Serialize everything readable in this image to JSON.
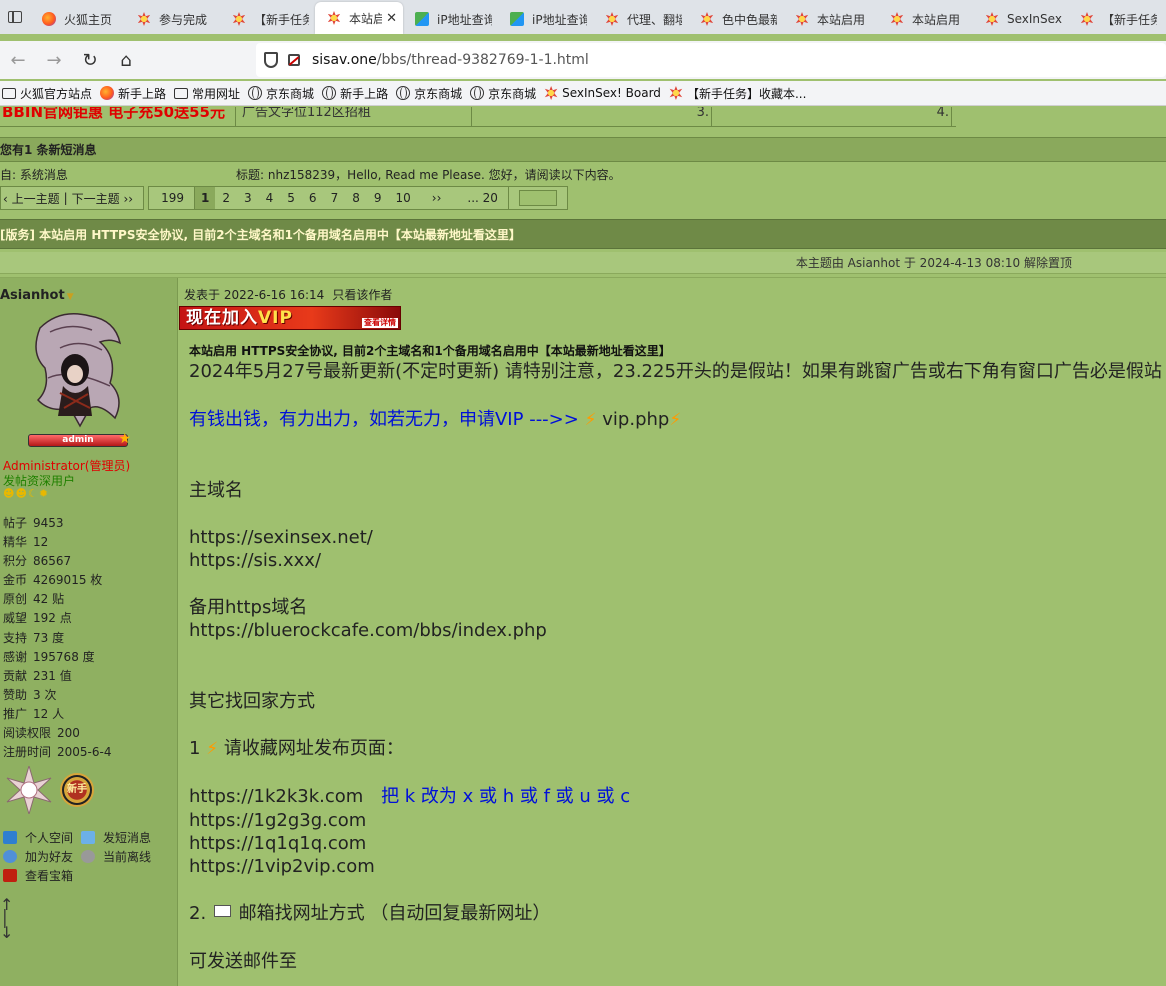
{
  "tabs": [
    {
      "label": "火狐主页",
      "icon": "firefox-icon"
    },
    {
      "label": "参与完成",
      "icon": "flower-icon"
    },
    {
      "label": "【新手任务",
      "icon": "flower-icon"
    },
    {
      "label": "本站启",
      "icon": "flower-icon",
      "active": true
    },
    {
      "label": "iP地址查询",
      "icon": "ip-lookup-icon"
    },
    {
      "label": "iP地址查询",
      "icon": "ip-lookup-icon"
    },
    {
      "label": "代理、翻墙",
      "icon": "flower-icon"
    },
    {
      "label": "色中色最新",
      "icon": "flower-icon"
    },
    {
      "label": "本站启用",
      "icon": "flower-icon"
    },
    {
      "label": "本站启用",
      "icon": "flower-icon"
    },
    {
      "label": "SexInSex",
      "icon": "flower-icon"
    },
    {
      "label": "【新手任务",
      "icon": "flower-icon"
    }
  ],
  "tab_close": "✕",
  "url": {
    "host": "sisav.one",
    "path": "/bbs/thread-9382769-1-1.html"
  },
  "bookmarks": [
    {
      "label": "火狐官方站点",
      "icon": "folder-icon"
    },
    {
      "label": "新手上路",
      "icon": "firefox-icon"
    },
    {
      "label": "常用网址",
      "icon": "folder-icon"
    },
    {
      "label": "京东商城",
      "icon": "globe-icon"
    },
    {
      "label": "新手上路",
      "icon": "globe-icon"
    },
    {
      "label": "京东商城",
      "icon": "globe-icon"
    },
    {
      "label": "京东商城",
      "icon": "globe-icon"
    },
    {
      "label": "SexInSex! Board",
      "icon": "flower-icon"
    },
    {
      "label": "【新手任务】收藏本...",
      "icon": "flower-icon"
    }
  ],
  "ad_row": {
    "red": "BBIN官网钜惠 电子充50送55元",
    "text": "广告文字位112区招租",
    "n3": "3.",
    "n4": "4."
  },
  "pm": {
    "header": "您有1 条新短消息",
    "from": "自: 系统消息",
    "subject": "标题: nhz158239，Hello, Read me Please. 您好，请阅读以下内容。"
  },
  "thread_nav": {
    "prev": "‹ 上一主题",
    "sep": "|",
    "next": "下一主题 ››"
  },
  "pager": {
    "total": "199",
    "current": "1",
    "pages": [
      "2",
      "3",
      "4",
      "5",
      "6",
      "7",
      "8",
      "9",
      "10"
    ],
    "next": "››",
    "last": "... 20"
  },
  "thread_title": {
    "prefix": "[版务]",
    "text": "本站启用 HTTPS安全协议, 目前2个主域名和1个备用域名启用中【本站最新地址看这里】"
  },
  "mod_info": "本主题由 Asianhot 于 2024-4-13 08:10 解除置顶",
  "author": {
    "name": "Asianhot",
    "badge": "admin",
    "group": "Administrator(管理员)",
    "title": "发帖资深用户",
    "stats": [
      {
        "label": "帖子",
        "value": "9453"
      },
      {
        "label": "精华",
        "value": "12"
      },
      {
        "label": "积分",
        "value": "86567"
      },
      {
        "label": "金币",
        "value": "4269015 枚"
      },
      {
        "label": "原创",
        "value": "42 贴"
      },
      {
        "label": "威望",
        "value": "192 点"
      },
      {
        "label": "支持",
        "value": "73 度"
      },
      {
        "label": "感谢",
        "value": "195768 度"
      },
      {
        "label": "贡献",
        "value": "231 值"
      },
      {
        "label": "赞助",
        "value": "3 次"
      },
      {
        "label": "推广",
        "value": "12 人"
      },
      {
        "label": "阅读权限",
        "value": "200"
      },
      {
        "label": "注册时间",
        "value": "2005-6-4"
      }
    ],
    "medal2_text": "新手",
    "links": {
      "space": "个人空间",
      "send_pm": "发短消息",
      "add_friend": "加为好友",
      "offline": "当前离线",
      "treasure": "查看宝箱"
    }
  },
  "post": {
    "posted": "发表于 2022-6-16 16:14",
    "only_author": "只看该作者",
    "banner": {
      "prefix": "现在加入",
      "vip": "VIP",
      "detail": "查看详情"
    },
    "title": "本站启用 HTTPS安全协议, 目前2个主域名和1个备用域名启用中【本站最新地址看这里】",
    "notice": "2024年5月27号最新更新(不定时更新) 请特别注意，23.225开头的是假站！如果有跳窗广告或右下角有窗口广告必是假站",
    "vip_line": "有钱出钱，有力出力，如若无力，申请VIP --->>",
    "vip_link": "vip.php",
    "main_domain_label": "主域名",
    "domains": [
      "https://sexinsex.net/",
      "https://sis.xxx/"
    ],
    "backup_label": "备用https域名",
    "backup_domain": "https://bluerockcafe.com/bbs/index.php",
    "other_label": "其它找回家方式",
    "step1_num": "1",
    "step1_text": "请收藏网址发布页面：",
    "mirror_first": "https://1k2k3k.com",
    "mirror_hint": "把 k 改为 x 或 h 或 f 或 u 或 c",
    "mirrors": [
      "https://1g2g3g.com",
      "https://1q1q1q.com",
      "https://1vip2vip.com"
    ],
    "step2_num": "2.",
    "step2_text": "邮箱找网址方式 （自动回复最新网址）",
    "send_to": "可发送邮件至"
  },
  "colors": {
    "page_bg": "#9fc06f",
    "title_bar": "#6f8a47",
    "blue_link": "#0010d8",
    "red_ad": "#e00000",
    "admin_red": "#e00000",
    "title_green": "#208000"
  }
}
